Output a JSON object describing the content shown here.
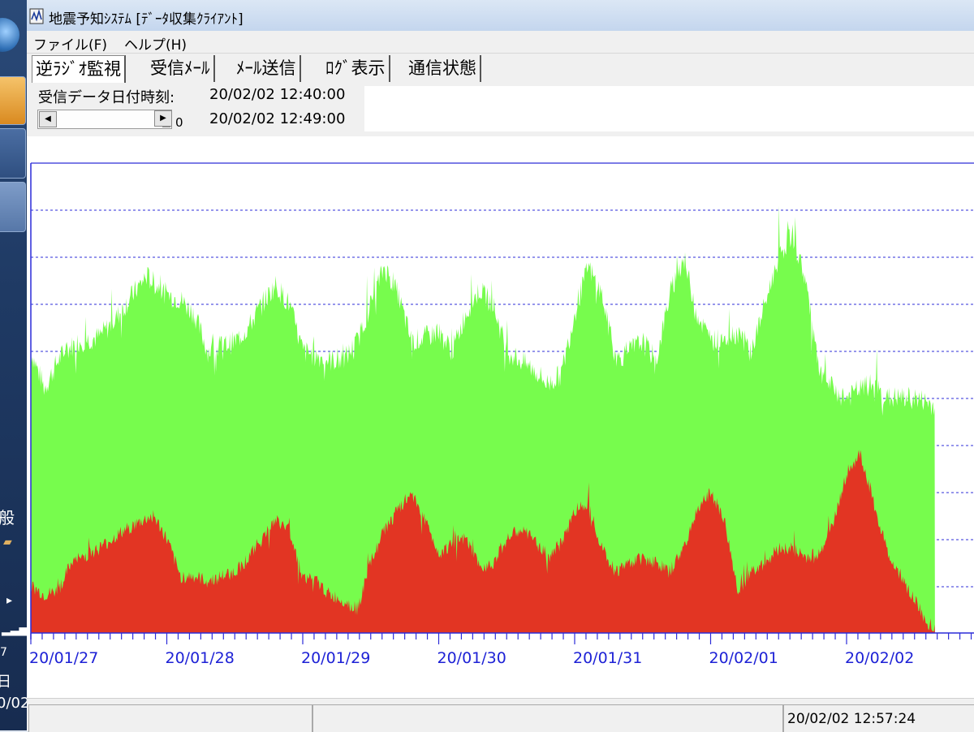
{
  "window": {
    "title": "地震予知ｼｽﾃﾑ [ﾃﾞｰﾀ収集ｸﾗｲｱﾝﾄ]"
  },
  "menu": {
    "file": "ファイル(F)",
    "help": "ヘルプ(H)"
  },
  "tabs": [
    {
      "label": "逆ﾗｼﾞｵ監視"
    },
    {
      "label": "受信ﾒｰﾙ"
    },
    {
      "label": "ﾒｰﾙ送信"
    },
    {
      "label": "ﾛｸﾞ表示"
    },
    {
      "label": "通信状態"
    }
  ],
  "info": {
    "received_label": "受信データ日付時刻:",
    "received_time": "20/02/02 12:40:00",
    "second_time": "20/02/02 12:49:00",
    "scroll_value": "0"
  },
  "desktop": {
    "kanji": "般",
    "day": "日",
    "date": "0/02",
    "digit": "7"
  },
  "status": {
    "clock": "20/02/02 12:57:24"
  },
  "colors": {
    "green": "#77fc4d",
    "red": "#e23523",
    "axis": "#2c2cd8",
    "label": "#1e22d6"
  },
  "chart_data": {
    "type": "area",
    "x_tick_labels": [
      "20/01/27",
      "20/01/28",
      "20/01/29",
      "20/01/30",
      "20/01/31",
      "20/02/01",
      "20/02/02"
    ],
    "y_grid_lines": 9,
    "grid": true,
    "series": [
      {
        "color": "green",
        "x": [
          0,
          0.1,
          0.2,
          0.25,
          0.35,
          0.5,
          0.6,
          0.7,
          0.85,
          1.0,
          1.1,
          1.2,
          1.3,
          1.4,
          1.5,
          1.6,
          1.7,
          1.8,
          1.9,
          2.0,
          2.1,
          2.2,
          2.3,
          2.4,
          2.5,
          2.6,
          2.7,
          2.8,
          2.9,
          3.0,
          3.1,
          3.2,
          3.3,
          3.4,
          3.5,
          3.6,
          3.7,
          3.8,
          3.9,
          4.0,
          4.1,
          4.2,
          4.3,
          4.4,
          4.5,
          4.6,
          4.7,
          4.8,
          4.9,
          5.0,
          5.1,
          5.2,
          5.3,
          5.4,
          5.5,
          5.6,
          5.7,
          5.8,
          5.9,
          6.0,
          6.1,
          6.2,
          6.25,
          6.3,
          6.4,
          6.5,
          6.6,
          6.65
        ],
        "values": [
          60,
          52,
          58,
          60,
          62,
          63,
          66,
          70,
          76,
          72,
          71,
          68,
          60,
          61,
          62,
          65,
          70,
          74,
          70,
          60,
          59,
          58,
          58,
          62,
          70,
          78,
          72,
          62,
          63,
          64,
          60,
          68,
          73,
          70,
          60,
          58,
          56,
          53,
          55,
          68,
          78,
          72,
          58,
          60,
          62,
          58,
          72,
          80,
          68,
          62,
          63,
          64,
          60,
          70,
          80,
          85,
          75,
          55,
          52,
          50,
          52,
          53,
          51,
          50,
          50,
          50,
          49,
          48
        ]
      },
      {
        "color": "red",
        "x": [
          0,
          0.1,
          0.2,
          0.3,
          0.5,
          0.7,
          0.9,
          1.0,
          1.1,
          1.2,
          1.3,
          1.4,
          1.5,
          1.6,
          1.7,
          1.8,
          1.9,
          2.0,
          2.1,
          2.2,
          2.3,
          2.4,
          2.5,
          2.6,
          2.7,
          2.8,
          2.9,
          3.0,
          3.1,
          3.2,
          3.3,
          3.4,
          3.5,
          3.6,
          3.7,
          3.8,
          3.9,
          4.0,
          4.1,
          4.2,
          4.3,
          4.4,
          4.5,
          4.6,
          4.7,
          4.8,
          4.9,
          5.0,
          5.1,
          5.2,
          5.3,
          5.4,
          5.5,
          5.6,
          5.7,
          5.8,
          5.9,
          6.0,
          6.1,
          6.2,
          6.3,
          6.4,
          6.5,
          6.6,
          6.65
        ],
        "values": [
          10,
          8,
          9,
          15,
          18,
          22,
          25,
          20,
          12,
          12,
          11,
          12,
          13,
          16,
          20,
          24,
          22,
          12,
          11,
          8,
          7,
          5,
          15,
          22,
          26,
          30,
          24,
          17,
          19,
          20,
          14,
          15,
          20,
          22,
          20,
          16,
          19,
          26,
          28,
          18,
          13,
          15,
          16,
          15,
          13,
          18,
          26,
          30,
          24,
          9,
          13,
          15,
          18,
          18,
          16,
          17,
          23,
          34,
          38,
          28,
          17,
          12,
          7,
          2,
          1
        ]
      }
    ]
  }
}
